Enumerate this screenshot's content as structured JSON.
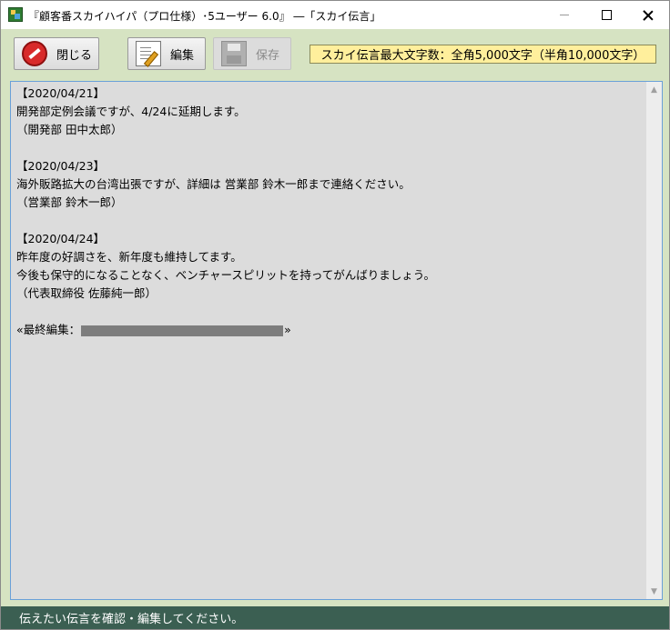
{
  "window": {
    "title": "『顧客番スカイハイパ（プロ仕様）･5ユーザー 6.0』 ―「スカイ伝言」",
    "app_icon": "app-icon",
    "controls": {
      "minimize": "minimize-icon",
      "maximize": "maximize-icon",
      "close": "close-icon"
    }
  },
  "toolbar": {
    "close_label": "閉じる",
    "close_icon": "stop-icon",
    "edit_label": "編集",
    "edit_icon": "edit-icon",
    "save_label": "保存",
    "save_icon": "floppy-disk-icon",
    "save_enabled": false,
    "limit_label": "スカイ伝言最大文字数：全角5,000文字（半角10,000文字）"
  },
  "message": {
    "lines": [
      "【2020/04/21】",
      "開発部定例会議ですが、4/24に延期します。",
      "（開発部 田中太郎）",
      "",
      "【2020/04/23】",
      "海外販路拡大の台湾出張ですが、詳細は 営業部 鈴木一郎まで連絡ください。",
      "（営業部 鈴木一郎）",
      "",
      "【2020/04/24】",
      "昨年度の好調さを、新年度も維持してます。",
      "今後も保守的になることなく、ベンチャースピリットを持ってがんばりましょう。",
      "（代表取締役 佐藤純一郎）",
      ""
    ],
    "last_edit_prefix": "«最終編集：",
    "last_edit_suffix": "»"
  },
  "scrollbar": {
    "up_icon": "scroll-up-arrow-icon",
    "down_icon": "scroll-down-arrow-icon"
  },
  "status": {
    "text": "伝えたい伝言を確認・編集してください。"
  },
  "colors": {
    "window_bg": "#d6e3c2",
    "text_area_bg": "#dcdcdc",
    "text_area_border": "#6aa0d8",
    "limit_bg": "#ffef9c",
    "status_bg": "#3b5f52"
  }
}
